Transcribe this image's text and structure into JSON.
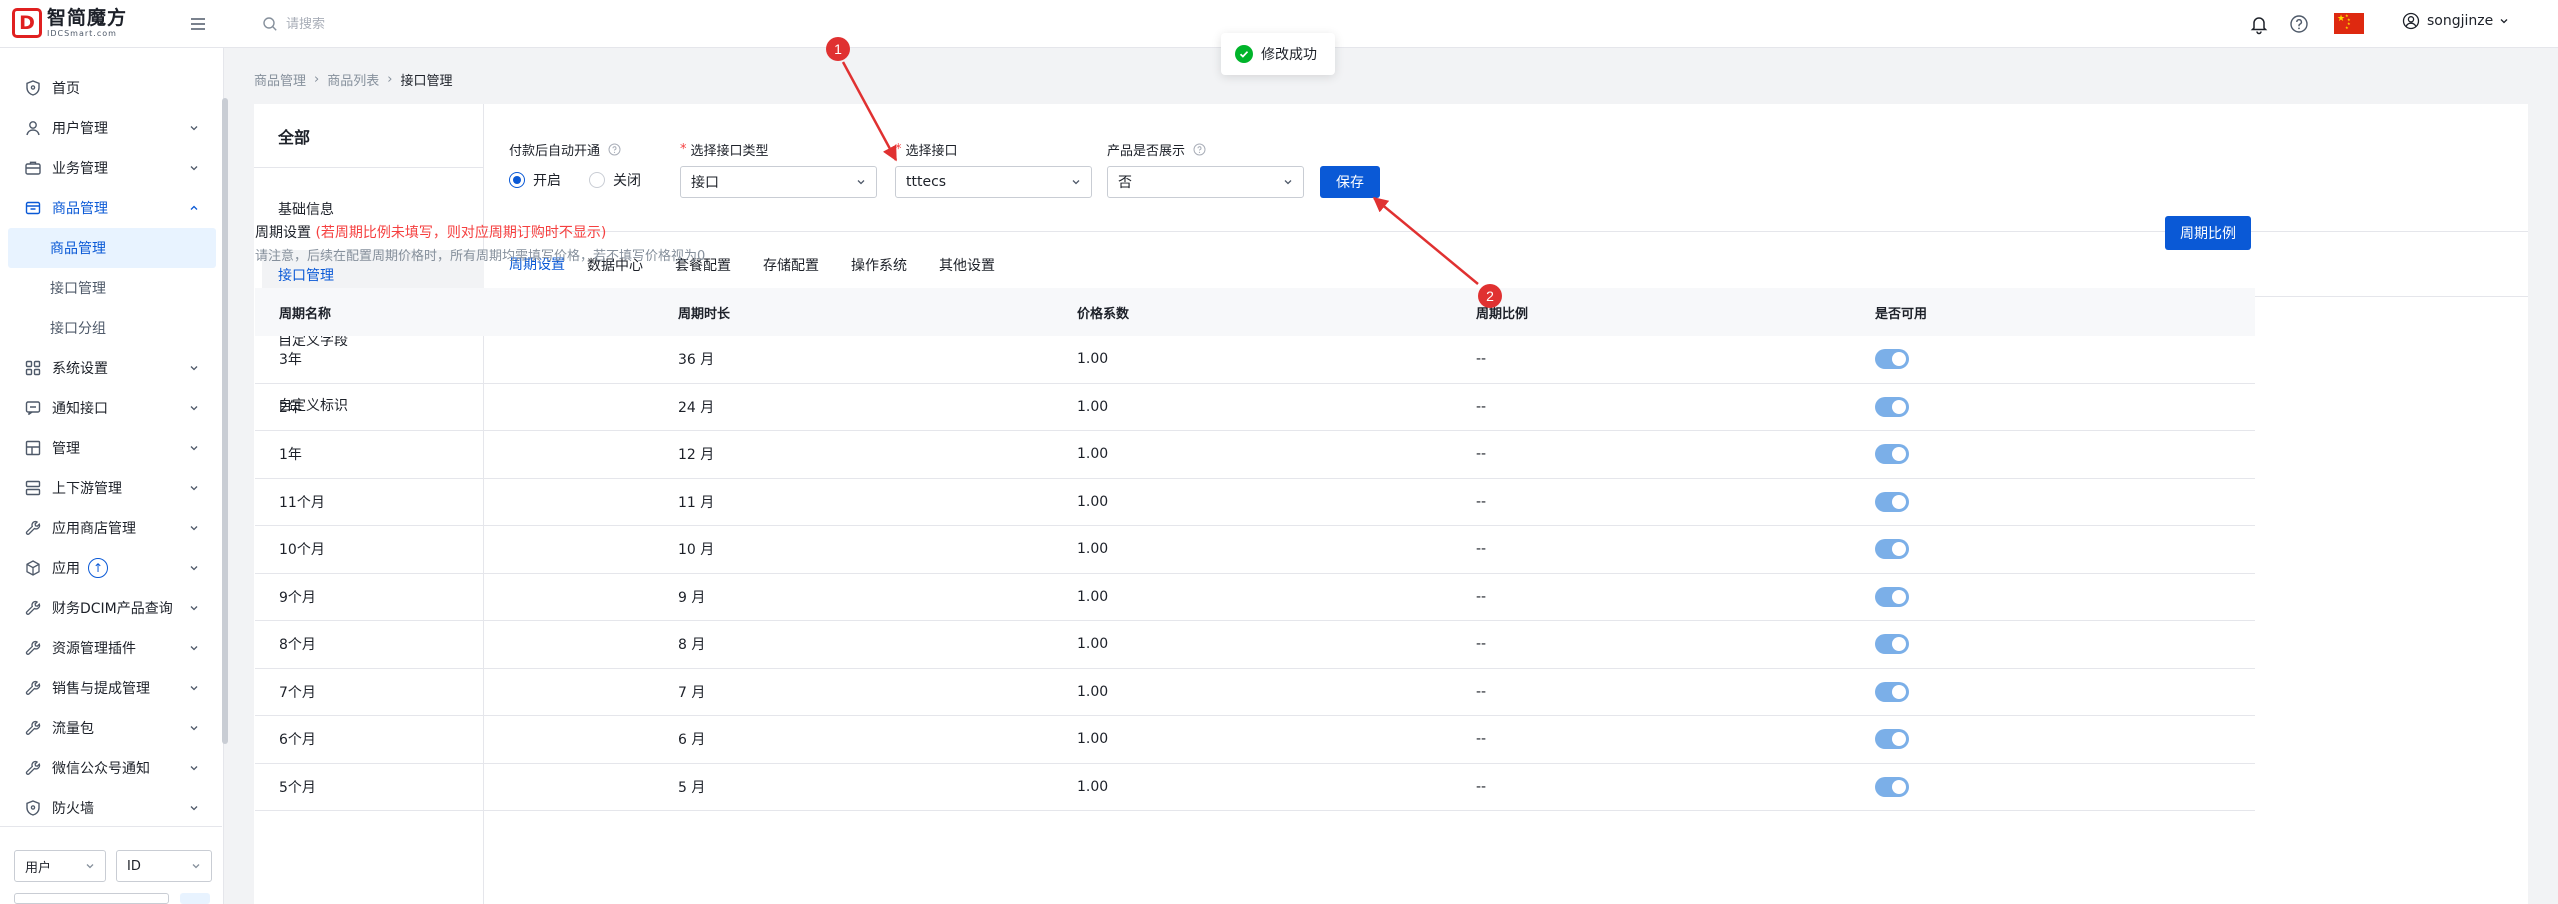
{
  "topbar": {
    "logo_mark": "D",
    "logo_main": "智简魔方",
    "logo_sub": "IDCSmart.com",
    "search_placeholder": "请搜索",
    "user_name": "songjinze"
  },
  "sidebar": {
    "items": [
      {
        "label": "首页",
        "icon": "shield-icon"
      },
      {
        "label": "用户管理",
        "icon": "user-icon"
      },
      {
        "label": "业务管理",
        "icon": "briefcase-icon"
      },
      {
        "label": "商品管理",
        "icon": "box-icon"
      },
      {
        "label": "系统设置",
        "icon": "apps-icon"
      },
      {
        "label": "通知接口",
        "icon": "message-icon"
      },
      {
        "label": "管理",
        "icon": "grid-icon"
      },
      {
        "label": "上下游管理",
        "icon": "layers-icon"
      },
      {
        "label": "应用商店管理",
        "icon": "tool-icon"
      },
      {
        "label": "应用",
        "icon": "cube-icon"
      },
      {
        "label": "财务DCIM产品查询",
        "icon": "tool-icon"
      },
      {
        "label": "资源管理插件",
        "icon": "tool-icon"
      },
      {
        "label": "销售与提成管理",
        "icon": "tool-icon"
      },
      {
        "label": "流量包",
        "icon": "tool-icon"
      },
      {
        "label": "微信公众号通知",
        "icon": "tool-icon"
      },
      {
        "label": "防火墙",
        "icon": "shield-icon"
      }
    ],
    "sub_items": [
      "商品管理",
      "接口管理",
      "接口分组"
    ],
    "app_badge": "↑",
    "filter_left": "用户",
    "filter_right": "ID"
  },
  "breadcrumb": [
    "商品管理",
    "商品列表",
    "接口管理"
  ],
  "left_nav": {
    "header": "全部",
    "items": [
      "基础信息",
      "接口管理",
      "自定义字段",
      "自定义标识"
    ]
  },
  "config": {
    "auto_open_label": "付款后自动开通",
    "radio_on": "开启",
    "radio_off": "关闭",
    "type_label": "选择接口类型",
    "type_value": "接口",
    "iface_label": "选择接口",
    "iface_value": "tttecs",
    "show_label": "产品是否展示",
    "show_value": "否",
    "save_label": "保存"
  },
  "tabs": [
    "周期设置",
    "数据中心",
    "套餐配置",
    "存储配置",
    "操作系统",
    "其他设置"
  ],
  "cycle": {
    "title": "周期设置",
    "warning": "(若周期比例未填写，则对应周期订购时不显示)",
    "note": "请注意，后续在配置周期价格时，所有周期均需填写价格，若不填写价格视为0",
    "ratio_btn": "周期比例"
  },
  "table": {
    "headers": [
      "周期名称",
      "周期时长",
      "价格系数",
      "周期比例",
      "是否可用"
    ],
    "rows": [
      [
        "3年",
        "36 月",
        "1.00",
        "--"
      ],
      [
        "2年",
        "24 月",
        "1.00",
        "--"
      ],
      [
        "1年",
        "12 月",
        "1.00",
        "--"
      ],
      [
        "11个月",
        "11 月",
        "1.00",
        "--"
      ],
      [
        "10个月",
        "10 月",
        "1.00",
        "--"
      ],
      [
        "9个月",
        "9 月",
        "1.00",
        "--"
      ],
      [
        "8个月",
        "8 月",
        "1.00",
        "--"
      ],
      [
        "7个月",
        "7 月",
        "1.00",
        "--"
      ],
      [
        "6个月",
        "6 月",
        "1.00",
        "--"
      ],
      [
        "5个月",
        "5 月",
        "1.00",
        "--"
      ]
    ]
  },
  "toast": {
    "text": "修改成功"
  },
  "annotations": [
    "1",
    "2"
  ],
  "colors": {
    "accent": "#0a59d6",
    "danger": "#f53f3f",
    "success": "#00b42a",
    "annotation": "#e03131"
  }
}
